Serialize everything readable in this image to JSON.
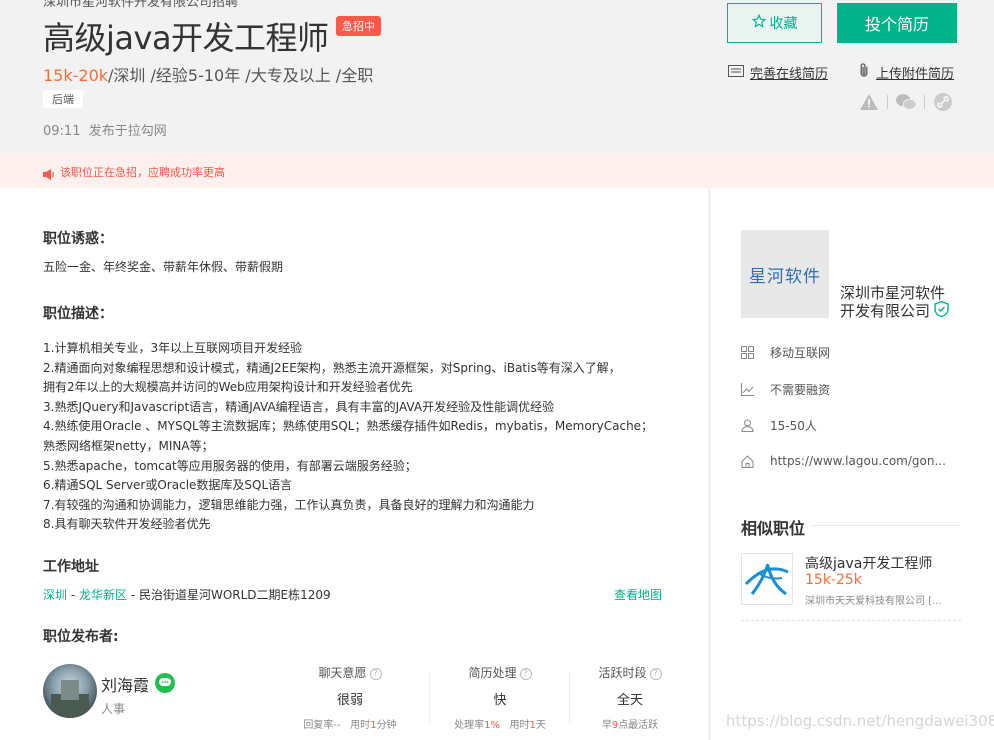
{
  "header": {
    "company_line": "深圳市星河软件开发有限公司招聘",
    "title": "高级java开发工程师",
    "urgent_badge": "急招中",
    "salary": "15k-20k",
    "city": "/深圳 /",
    "experience": "经验5-10年 /",
    "education": "大专及以上 /",
    "job_type": "全职",
    "tag": "后端",
    "publish_time": "09:11",
    "publish_source": "发布于拉勾网",
    "fav_label": "收藏",
    "apply_label": "投个简历",
    "online_resume_label": "完善在线简历",
    "attach_resume_label": "上传附件简历"
  },
  "notice": {
    "text": "该职位正在急招，应聘成功率更高"
  },
  "job": {
    "perk_title": "职位诱惑：",
    "perk_text": "五险一金、年终奖金、带薪年休假、带薪假期",
    "desc_title": "职位描述：",
    "desc_lines": [
      "1.计算机相关专业，3年以上互联网项目开发经验",
      "2.精通面向对象编程思想和设计模式，精通J2EE架构，熟悉主流开源框架，对Spring、iBatis等有深入了解，",
      "拥有2年以上的大规模高并访问的Web应用架构设计和开发经验者优先",
      "3.熟悉JQuery和Javascript语言，精通JAVA编程语言，具有丰富的JAVA开发经验及性能调优经验",
      "4.熟练使用Oracle 、MYSQL等主流数据库；熟练使用SQL；熟悉缓存插件如Redis，mybatis，MemoryCache；",
      "熟悉网络框架netty，MINA等；",
      "5.熟悉apache，tomcat等应用服务器的使用，有部署云端服务经验；",
      "6.精通SQL Server或Oracle数据库及SQL语言",
      "7.有较强的沟通和协调能力，逻辑思维能力强，工作认真负责，具备良好的理解力和沟通能力",
      "8.具有聊天软件开发经验者优先"
    ],
    "address_title": "工作地址",
    "address_city": "深圳",
    "address_district": "龙华新区",
    "address_sep1": " - ",
    "address_sep2": " - ",
    "address_detail": "民治街道星河WORLD二期E栋1209",
    "map_link": "查看地图",
    "publisher_title": "职位发布者:"
  },
  "recruiter": {
    "name": "刘海霞",
    "role": "人事",
    "stats": [
      {
        "label": "聊天意愿",
        "value": "很弱",
        "sub_a": "回复率--",
        "sub_b_pre": "用时",
        "sub_b_hl": "1",
        "sub_b_post": "分钟"
      },
      {
        "label": "简历处理",
        "value": "快",
        "sub_a_pre": "处理率",
        "sub_a_hl": "1%",
        "sub_b_pre": "用时",
        "sub_b_hl": "1",
        "sub_b_post": "天"
      },
      {
        "label": "活跃时段",
        "value": "全天",
        "sub_pre": "早",
        "sub_hl": "9",
        "sub_post": "点最活跃"
      }
    ]
  },
  "company": {
    "logo_text": "星河软件",
    "name_line1": "深圳市星河软件",
    "name_line2": "开发有限公司",
    "industry": "移动互联网",
    "financing": "不需要融资",
    "size": "15-50人",
    "website": "https://www.lagou.com/gon..."
  },
  "similar": {
    "title": "相似职位",
    "items": [
      {
        "job": "高级java开发工程师",
        "salary": "15k-25k",
        "company": "深圳市天天爱科技有限公司 [..."
      }
    ]
  },
  "watermark": "https://blog.csdn.net/hengdawei3087",
  "colors": {
    "accent": "#00b38a",
    "salary": "#fa6e36",
    "urgent": "#fa5a49"
  }
}
